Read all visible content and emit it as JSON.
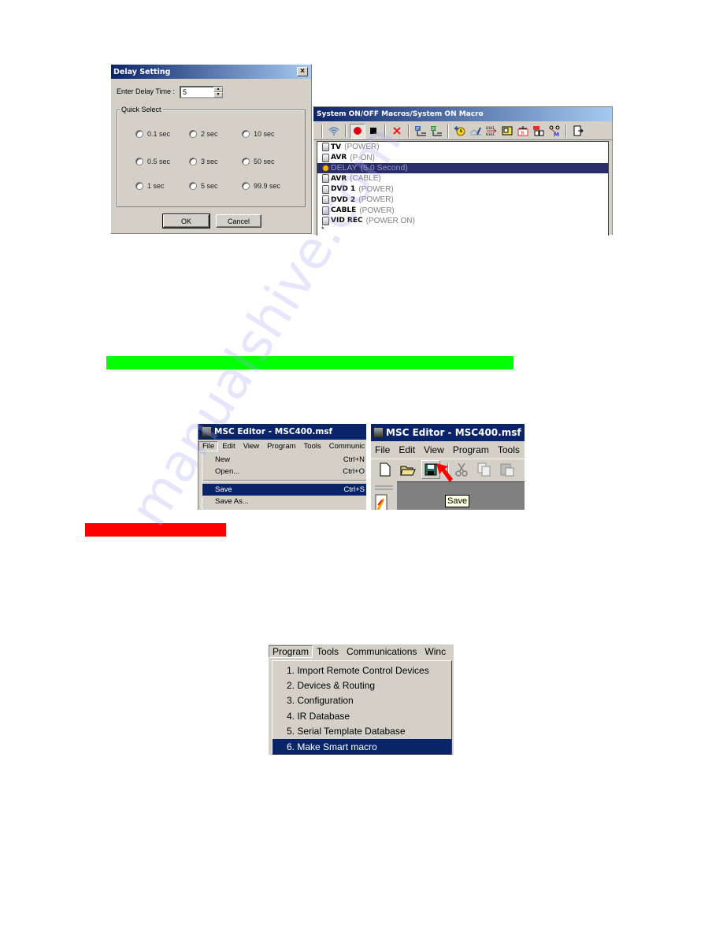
{
  "delay_dialog": {
    "title": "Delay Setting",
    "close_glyph": "×",
    "delay_label": "Enter Delay Time :",
    "delay_value": "5",
    "spin_up": "▲",
    "spin_down": "▼",
    "group_label": "Quick Select",
    "quick_options": [
      "0.1 sec",
      "2 sec",
      "10 sec",
      "0.5 sec",
      "3 sec",
      "50 sec",
      "1 sec",
      "5 sec",
      "99.9 sec"
    ],
    "ok_label": "OK",
    "cancel_label": "Cancel"
  },
  "macro_window": {
    "title": "System ON/OFF Macros/System ON Macro",
    "toolbar_icons": [
      "wireless-icon",
      "record-icon",
      "stop-icon",
      "delete-icon",
      "if-block-icon",
      "do-block-icon",
      "add-delay-icon",
      "edit-icon",
      "convert-icon",
      "paste-icon",
      "macro-call-icon",
      "routing-icon",
      "smart-macro-icon",
      "exit-icon"
    ],
    "steps": [
      {
        "device": "TV",
        "command": "(POWER)",
        "selected": false
      },
      {
        "device": "AVR",
        "command": "(P-ON)",
        "selected": false
      },
      {
        "device": "DELAY",
        "command": "(5.0 Second)",
        "selected": true
      },
      {
        "device": "AVR",
        "command": "(CABLE)",
        "selected": false
      },
      {
        "device": "DVD 1",
        "command": "(POWER)",
        "selected": false
      },
      {
        "device": "DVD 2",
        "command": "(POWER)",
        "selected": false
      },
      {
        "device": "CABLE",
        "command": "(POWER)",
        "selected": false
      },
      {
        "device": "VID REC",
        "command": "(POWER ON)",
        "selected": false
      }
    ],
    "end_marker": "*"
  },
  "highlights": {
    "green_bar_color": "#00ff00",
    "red_bar_color": "#ff0000"
  },
  "file_menu_shot": {
    "title": "MSC Editor - MSC400.msf",
    "menubar": [
      "File",
      "Edit",
      "View",
      "Program",
      "Tools",
      "Communic"
    ],
    "items": [
      {
        "label": "New",
        "shortcut": "Ctrl+N"
      },
      {
        "label": "Open...",
        "shortcut": "Ctrl+O"
      },
      {
        "label": "Save",
        "shortcut": "Ctrl+S"
      },
      {
        "label": "Save As...",
        "shortcut": ""
      }
    ]
  },
  "save_toolbar_shot": {
    "title": "MSC Editor - MSC400.msf",
    "menubar": [
      "File",
      "Edit",
      "View",
      "Program",
      "Tools"
    ],
    "tooltip": "Save"
  },
  "program_menu_shot": {
    "menubar": [
      "Program",
      "Tools",
      "Communications",
      "Winc"
    ],
    "items": [
      "1. Import Remote Control Devices",
      "2. Devices & Routing",
      "3. Configuration",
      "4. IR Database",
      "5. Serial Template Database",
      "6. Make Smart macro"
    ]
  },
  "watermark": "manualshive.com"
}
